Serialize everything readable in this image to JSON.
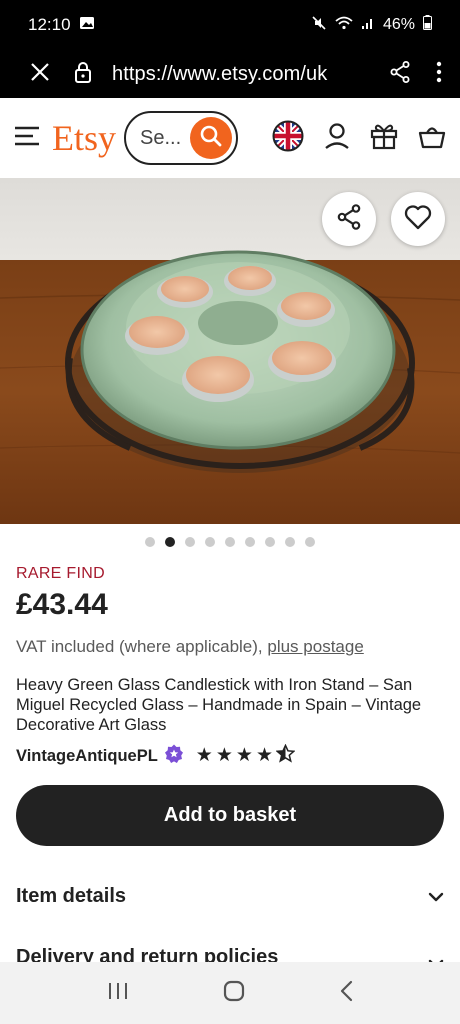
{
  "status": {
    "time": "12:10",
    "battery": "46%"
  },
  "browser": {
    "url": "https://www.etsy.com/uk"
  },
  "header": {
    "logo": "Etsy",
    "search_placeholder": "Se..."
  },
  "gallery": {
    "image_count": 9,
    "active_index": 1
  },
  "product": {
    "badge": "RARE FIND",
    "price": "£43.44",
    "vat_text": "VAT included (where applicable),",
    "vat_link": "plus postage",
    "title": "Heavy Green Glass Candlestick with Iron Stand – San Miguel Recycled Glass – Handmade in Spain – Vintage Decorative Art Glass",
    "shop_name": "VintageAntiquePL",
    "rating": 4.5,
    "add_to_basket": "Add to basket"
  },
  "sections": [
    {
      "label": "Item details"
    },
    {
      "label": "Delivery and return policies"
    }
  ],
  "colors": {
    "brand_orange": "#F1641E",
    "rare_find": "#A61A2E",
    "dark": "#222222"
  }
}
